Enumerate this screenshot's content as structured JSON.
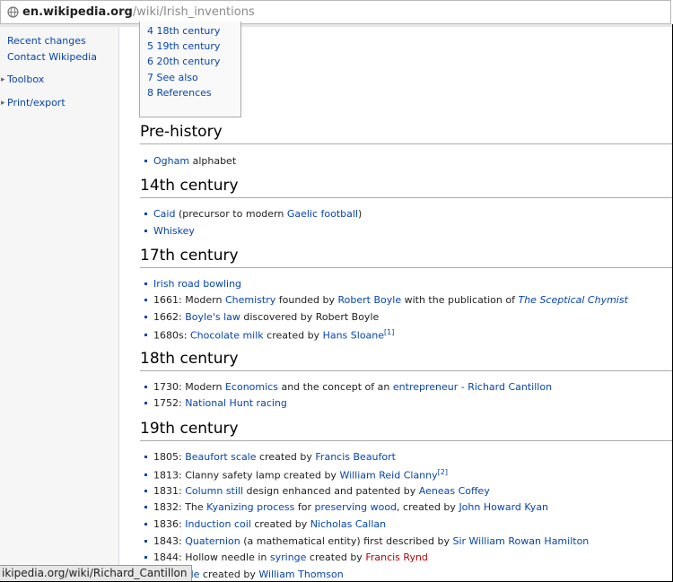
{
  "browser": {
    "url_host": "en.wikipedia.org",
    "url_path": "/wiki/Irish_inventions",
    "status_url": "ikipedia.org/wiki/Richard_Cantillon"
  },
  "sidebar": {
    "links": [
      "Recent changes",
      "Contact Wikipedia"
    ],
    "sections": [
      "Toolbox",
      "Print/export"
    ]
  },
  "toc": [
    {
      "num": "4",
      "label": "18th century"
    },
    {
      "num": "5",
      "label": "19th century"
    },
    {
      "num": "6",
      "label": "20th century"
    },
    {
      "num": "7",
      "label": "See also"
    },
    {
      "num": "8",
      "label": "References"
    }
  ],
  "sections": {
    "prehistory": {
      "title": "Pre-history",
      "items": [
        {
          "link": "Ogham",
          "text": " alphabet"
        }
      ]
    },
    "c14": {
      "title": "14th century",
      "items": [
        {
          "link": "Caid",
          "text1": " (precursor to modern ",
          "link2": "Gaelic football",
          "text2": ")"
        },
        {
          "link": "Whiskey"
        }
      ]
    },
    "c17": {
      "title": "17th century",
      "items": [
        {
          "link": "Irish road bowling"
        },
        {
          "pre": "1661: Modern ",
          "link": "Chemistry",
          "t1": " founded by ",
          "link2": "Robert Boyle",
          "t2": " with the publication of ",
          "italic": "The Sceptical Chymist"
        },
        {
          "pre": "1662: ",
          "link": "Boyle's law",
          "t1": " discovered by Robert Boyle"
        },
        {
          "pre": "1680s: ",
          "link": "Chocolate milk",
          "t1": " created by ",
          "link2": "Hans Sloane",
          "sup": "[1]"
        }
      ]
    },
    "c18": {
      "title": "18th century",
      "items": [
        {
          "pre": "1730: Modern ",
          "link": "Economics",
          "t1": " and the concept of an ",
          "link2": "entrepreneur",
          "t2": " - ",
          "link3": "Richard Cantillon"
        },
        {
          "pre": "1752: ",
          "link": "National Hunt racing"
        }
      ]
    },
    "c19": {
      "title": "19th century",
      "items": [
        {
          "pre": "1805: ",
          "link": "Beaufort scale",
          "t1": " created by ",
          "link2": "Francis Beaufort"
        },
        {
          "pre": "1813: Clanny safety lamp created by ",
          "link": "William Reid Clanny",
          "sup": "[2]"
        },
        {
          "pre": "1831: ",
          "link": "Column still",
          "t1": " design enhanced and patented by ",
          "link2": "Aeneas Coffey"
        },
        {
          "pre": "1832: The ",
          "link": "Kyanizing process",
          "t1": " for ",
          "link2": "preserving wood",
          "t2": ", created by ",
          "link3": "John Howard Kyan"
        },
        {
          "pre": "1836: ",
          "link": "Induction coil",
          "t1": " created by ",
          "link2": "Nicholas Callan"
        },
        {
          "pre": "1843: ",
          "link": "Quaternion",
          "t1": " (a mathematical entity) first described by ",
          "link2": "Sir William Rowan Hamilton"
        },
        {
          "pre": "1844: Hollow needle in ",
          "link": "syringe",
          "t1": " created by ",
          "red": "Francis Rynd"
        },
        {
          "link": "lvin scale",
          "t1": " created by ",
          "link2": "William Thomson"
        }
      ]
    }
  },
  "colors": {
    "link": "#0645ad",
    "redlink": "#ba0000",
    "text": "#222222",
    "sidebar_bg": "#f6f6f6"
  }
}
